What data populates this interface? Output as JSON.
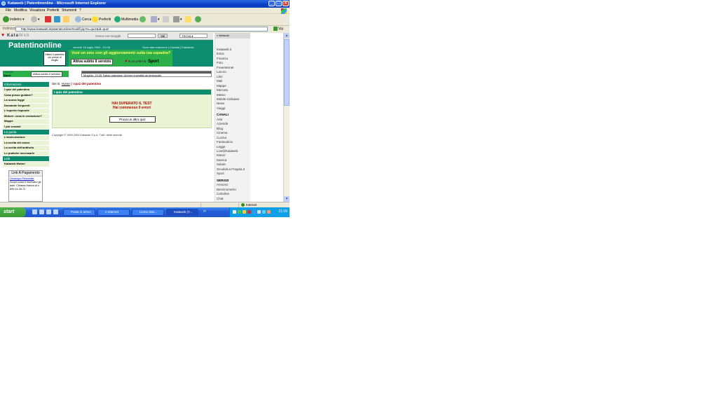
{
  "window": {
    "title": "Kataweb | Patentinonline - Microsoft Internet Explorer"
  },
  "menu": [
    "File",
    "Modifica",
    "Visualizza",
    "Preferiti",
    "Strumenti",
    "?"
  ],
  "toolbar": {
    "back": "Indietro",
    "search": "Cerca",
    "favorites": "Preferiti",
    "media": "Multimedia"
  },
  "address": {
    "label": "Indirizzo",
    "url": "http://www.kataweb.it/patentinonline/modifi.jsp?a=quiz&id=quiz",
    "go": "Vai"
  },
  "site": {
    "brand": "Kata",
    "brand2": "Web",
    "search_label": "Cerca con Google",
    "search_button": "Vai",
    "search_scope": "TROVA",
    "logo": "Patentinonline",
    "stamp": "Ottieni il patentino più presto di meglio",
    "date": "venerdì 16 luglio 2004 - 21:09",
    "toplinks": "Scrivi alla redazione | Contatti | Pubblicità",
    "ad_headline": "Vuoi un sms con gli aggiornamenti sulla tua squadra?",
    "ad_button": "Attiva subito il servizio",
    "ad_logo_brand": "KataWeb",
    "ad_logo_sport": "Sport",
    "left_strip_line1": "KataWeb",
    "left_strip_line2": "Sport",
    "left_strip_button": "Attiva subito il servizio",
    "ticker": "Mugello, 19:35 Twiolo olandase 14enne investita da motoscafo"
  },
  "leftnav": {
    "sections": [
      {
        "title": "Informazioni",
        "items": [
          "I quiz del patentino",
          "Cosa posso guidare?",
          "La nuova legge",
          "Domande frequenti",
          "L'esperto risponde",
          "Motore: cosa in evoluzione?",
          "Mappe",
          "I più venduti"
        ]
      },
      {
        "title": "La guida",
        "items": [
          "L'assicurazione",
          "La scelta del casco",
          "La scelta dell'antifurto",
          "Le pratiche necessarie"
        ]
      },
      {
        "title": "Link",
        "items": [
          "Kataweb Motori"
        ]
      }
    ],
    "linkbox_title": "Link A Pagamento",
    "linkbox_link": "Oroscopo Personale",
    "linkbox_text": "Scopri cosa ti riservano gli astri. Chiama Hanna al n. 899.24.28.72"
  },
  "main": {
    "breadcrumb_prefix": "Sei in:",
    "breadcrumb_home": "Home",
    "breadcrumb_current": "I quiz del patentino",
    "panel_title": "I quiz del patentino",
    "result_line1": "HAI SUPERATO IL TEST",
    "result_line2": "Hai commesso 0 errori",
    "retry_button": "Prova un altro quiz",
    "copyright": "Copyright © 1999-2004 Kataweb S.p.A. Tutti i diritti riservati"
  },
  "network": {
    "title": "» Network",
    "items_top": [
      "Kataweb.it",
      "Extra",
      "Finanza",
      "Foto",
      "FreeInternet",
      "Lavoro",
      "Libri",
      "Mail",
      "Mappe",
      "Mercato",
      "Meteo",
      "Mobile-Cellulare",
      "News",
      "Viaggi"
    ],
    "canali_title": "CANALI",
    "canali": [
      "Arte",
      "Aziende",
      "Blog",
      "Cinema",
      "Cucina",
      "Fantacalcio",
      "Legge",
      "Live@Kataweb",
      "Motori",
      "Musica",
      "Salute",
      "Scuola/La Fregola.it",
      "Sport"
    ],
    "servizi_title": "SERVIZI",
    "servizi": [
      "Annunci",
      "Benzinometro",
      "Cartoline",
      "Chat"
    ]
  },
  "statusbar": {
    "zone": "Internet"
  },
  "taskbar": {
    "start": "start",
    "tasks": [
      "Posta in arrivo",
      "2 Internet",
      "Uomo sitio...",
      "Kataweb (T...",
      "IT"
    ],
    "clock": "21:09"
  }
}
